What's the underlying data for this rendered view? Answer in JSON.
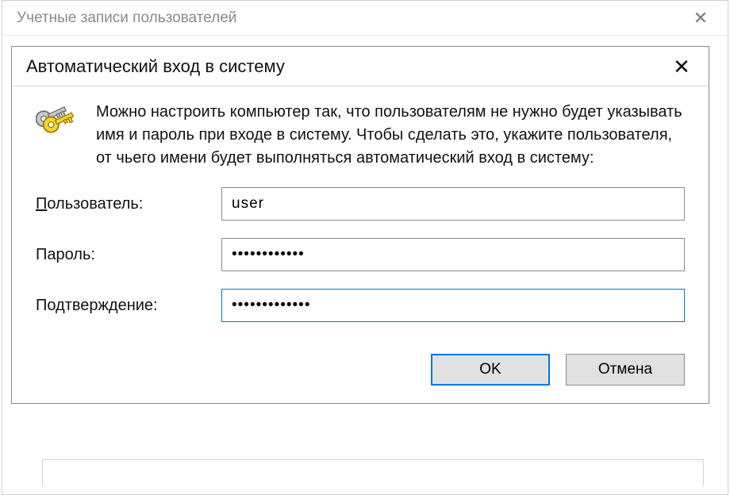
{
  "parentWindow": {
    "title": "Учетные записи пользователей"
  },
  "dialog": {
    "title": "Автоматический вход в систему",
    "description": "Можно настроить компьютер так, что пользователям не нужно будет указывать имя и пароль при входе в систему. Чтобы сделать это, укажите пользователя, от чьего имени будет выполняться автоматический вход в систему:",
    "labels": {
      "user_prefix": "П",
      "user_rest": "ользователь:",
      "password": "Пароль:",
      "confirm": "Подтверждение:"
    },
    "fields": {
      "user": "user",
      "password": "••••••••••••",
      "confirm": "•••••••••••••"
    },
    "buttons": {
      "ok": "OK",
      "cancel": "Отмена"
    }
  }
}
